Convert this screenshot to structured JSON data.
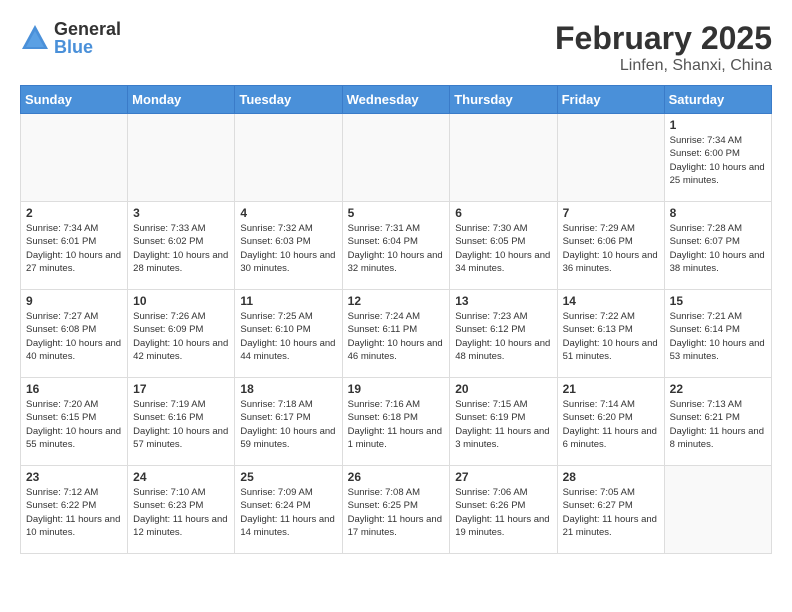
{
  "logo": {
    "general": "General",
    "blue": "Blue"
  },
  "title": "February 2025",
  "location": "Linfen, Shanxi, China",
  "weekdays": [
    "Sunday",
    "Monday",
    "Tuesday",
    "Wednesday",
    "Thursday",
    "Friday",
    "Saturday"
  ],
  "weeks": [
    [
      {
        "day": "",
        "info": ""
      },
      {
        "day": "",
        "info": ""
      },
      {
        "day": "",
        "info": ""
      },
      {
        "day": "",
        "info": ""
      },
      {
        "day": "",
        "info": ""
      },
      {
        "day": "",
        "info": ""
      },
      {
        "day": "1",
        "info": "Sunrise: 7:34 AM\nSunset: 6:00 PM\nDaylight: 10 hours and 25 minutes."
      }
    ],
    [
      {
        "day": "2",
        "info": "Sunrise: 7:34 AM\nSunset: 6:01 PM\nDaylight: 10 hours and 27 minutes."
      },
      {
        "day": "3",
        "info": "Sunrise: 7:33 AM\nSunset: 6:02 PM\nDaylight: 10 hours and 28 minutes."
      },
      {
        "day": "4",
        "info": "Sunrise: 7:32 AM\nSunset: 6:03 PM\nDaylight: 10 hours and 30 minutes."
      },
      {
        "day": "5",
        "info": "Sunrise: 7:31 AM\nSunset: 6:04 PM\nDaylight: 10 hours and 32 minutes."
      },
      {
        "day": "6",
        "info": "Sunrise: 7:30 AM\nSunset: 6:05 PM\nDaylight: 10 hours and 34 minutes."
      },
      {
        "day": "7",
        "info": "Sunrise: 7:29 AM\nSunset: 6:06 PM\nDaylight: 10 hours and 36 minutes."
      },
      {
        "day": "8",
        "info": "Sunrise: 7:28 AM\nSunset: 6:07 PM\nDaylight: 10 hours and 38 minutes."
      }
    ],
    [
      {
        "day": "9",
        "info": "Sunrise: 7:27 AM\nSunset: 6:08 PM\nDaylight: 10 hours and 40 minutes."
      },
      {
        "day": "10",
        "info": "Sunrise: 7:26 AM\nSunset: 6:09 PM\nDaylight: 10 hours and 42 minutes."
      },
      {
        "day": "11",
        "info": "Sunrise: 7:25 AM\nSunset: 6:10 PM\nDaylight: 10 hours and 44 minutes."
      },
      {
        "day": "12",
        "info": "Sunrise: 7:24 AM\nSunset: 6:11 PM\nDaylight: 10 hours and 46 minutes."
      },
      {
        "day": "13",
        "info": "Sunrise: 7:23 AM\nSunset: 6:12 PM\nDaylight: 10 hours and 48 minutes."
      },
      {
        "day": "14",
        "info": "Sunrise: 7:22 AM\nSunset: 6:13 PM\nDaylight: 10 hours and 51 minutes."
      },
      {
        "day": "15",
        "info": "Sunrise: 7:21 AM\nSunset: 6:14 PM\nDaylight: 10 hours and 53 minutes."
      }
    ],
    [
      {
        "day": "16",
        "info": "Sunrise: 7:20 AM\nSunset: 6:15 PM\nDaylight: 10 hours and 55 minutes."
      },
      {
        "day": "17",
        "info": "Sunrise: 7:19 AM\nSunset: 6:16 PM\nDaylight: 10 hours and 57 minutes."
      },
      {
        "day": "18",
        "info": "Sunrise: 7:18 AM\nSunset: 6:17 PM\nDaylight: 10 hours and 59 minutes."
      },
      {
        "day": "19",
        "info": "Sunrise: 7:16 AM\nSunset: 6:18 PM\nDaylight: 11 hours and 1 minute."
      },
      {
        "day": "20",
        "info": "Sunrise: 7:15 AM\nSunset: 6:19 PM\nDaylight: 11 hours and 3 minutes."
      },
      {
        "day": "21",
        "info": "Sunrise: 7:14 AM\nSunset: 6:20 PM\nDaylight: 11 hours and 6 minutes."
      },
      {
        "day": "22",
        "info": "Sunrise: 7:13 AM\nSunset: 6:21 PM\nDaylight: 11 hours and 8 minutes."
      }
    ],
    [
      {
        "day": "23",
        "info": "Sunrise: 7:12 AM\nSunset: 6:22 PM\nDaylight: 11 hours and 10 minutes."
      },
      {
        "day": "24",
        "info": "Sunrise: 7:10 AM\nSunset: 6:23 PM\nDaylight: 11 hours and 12 minutes."
      },
      {
        "day": "25",
        "info": "Sunrise: 7:09 AM\nSunset: 6:24 PM\nDaylight: 11 hours and 14 minutes."
      },
      {
        "day": "26",
        "info": "Sunrise: 7:08 AM\nSunset: 6:25 PM\nDaylight: 11 hours and 17 minutes."
      },
      {
        "day": "27",
        "info": "Sunrise: 7:06 AM\nSunset: 6:26 PM\nDaylight: 11 hours and 19 minutes."
      },
      {
        "day": "28",
        "info": "Sunrise: 7:05 AM\nSunset: 6:27 PM\nDaylight: 11 hours and 21 minutes."
      },
      {
        "day": "",
        "info": ""
      }
    ]
  ]
}
